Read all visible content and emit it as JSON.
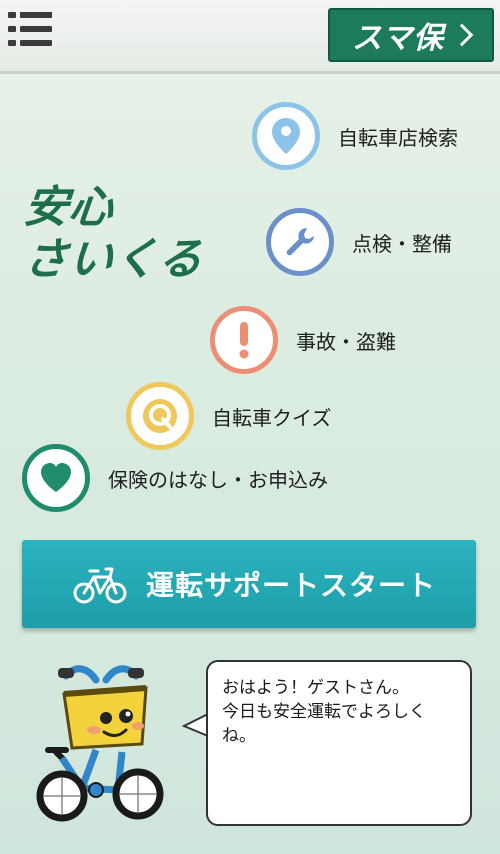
{
  "header": {
    "menu_icon": "hamburger-menu-icon",
    "sumaho_label": "スマ保",
    "sumaho_icon": "chevron-right-icon",
    "accent": "#1d7a5a"
  },
  "logo": {
    "line1": "安心",
    "line2": "さいくる",
    "color": "#1d6e4a"
  },
  "menu": {
    "shop_search": {
      "label": "自転車店検索",
      "icon": "map-pin-icon",
      "color": "#8cc3e8"
    },
    "inspection": {
      "label": "点検・整備",
      "icon": "wrench-icon",
      "color": "#6a8fc9"
    },
    "accident": {
      "label": "事故・盗難",
      "icon": "exclamation-icon",
      "color": "#eb8e73"
    },
    "quiz": {
      "label": "自転車クイズ",
      "icon": "quiz-q-icon",
      "color": "#eec85a"
    },
    "insurance": {
      "label": "保険のはなし・お申込み",
      "icon": "heart-icon",
      "color": "#1f8c6c"
    }
  },
  "start_button": {
    "label": "運転サポートスタート",
    "icon": "bicycle-icon",
    "color": "#23a9b5"
  },
  "bubble": {
    "line1": "おはよう！ゲストさん。",
    "line2": "今日も安全運転でよろしく",
    "line3": "ね。"
  }
}
